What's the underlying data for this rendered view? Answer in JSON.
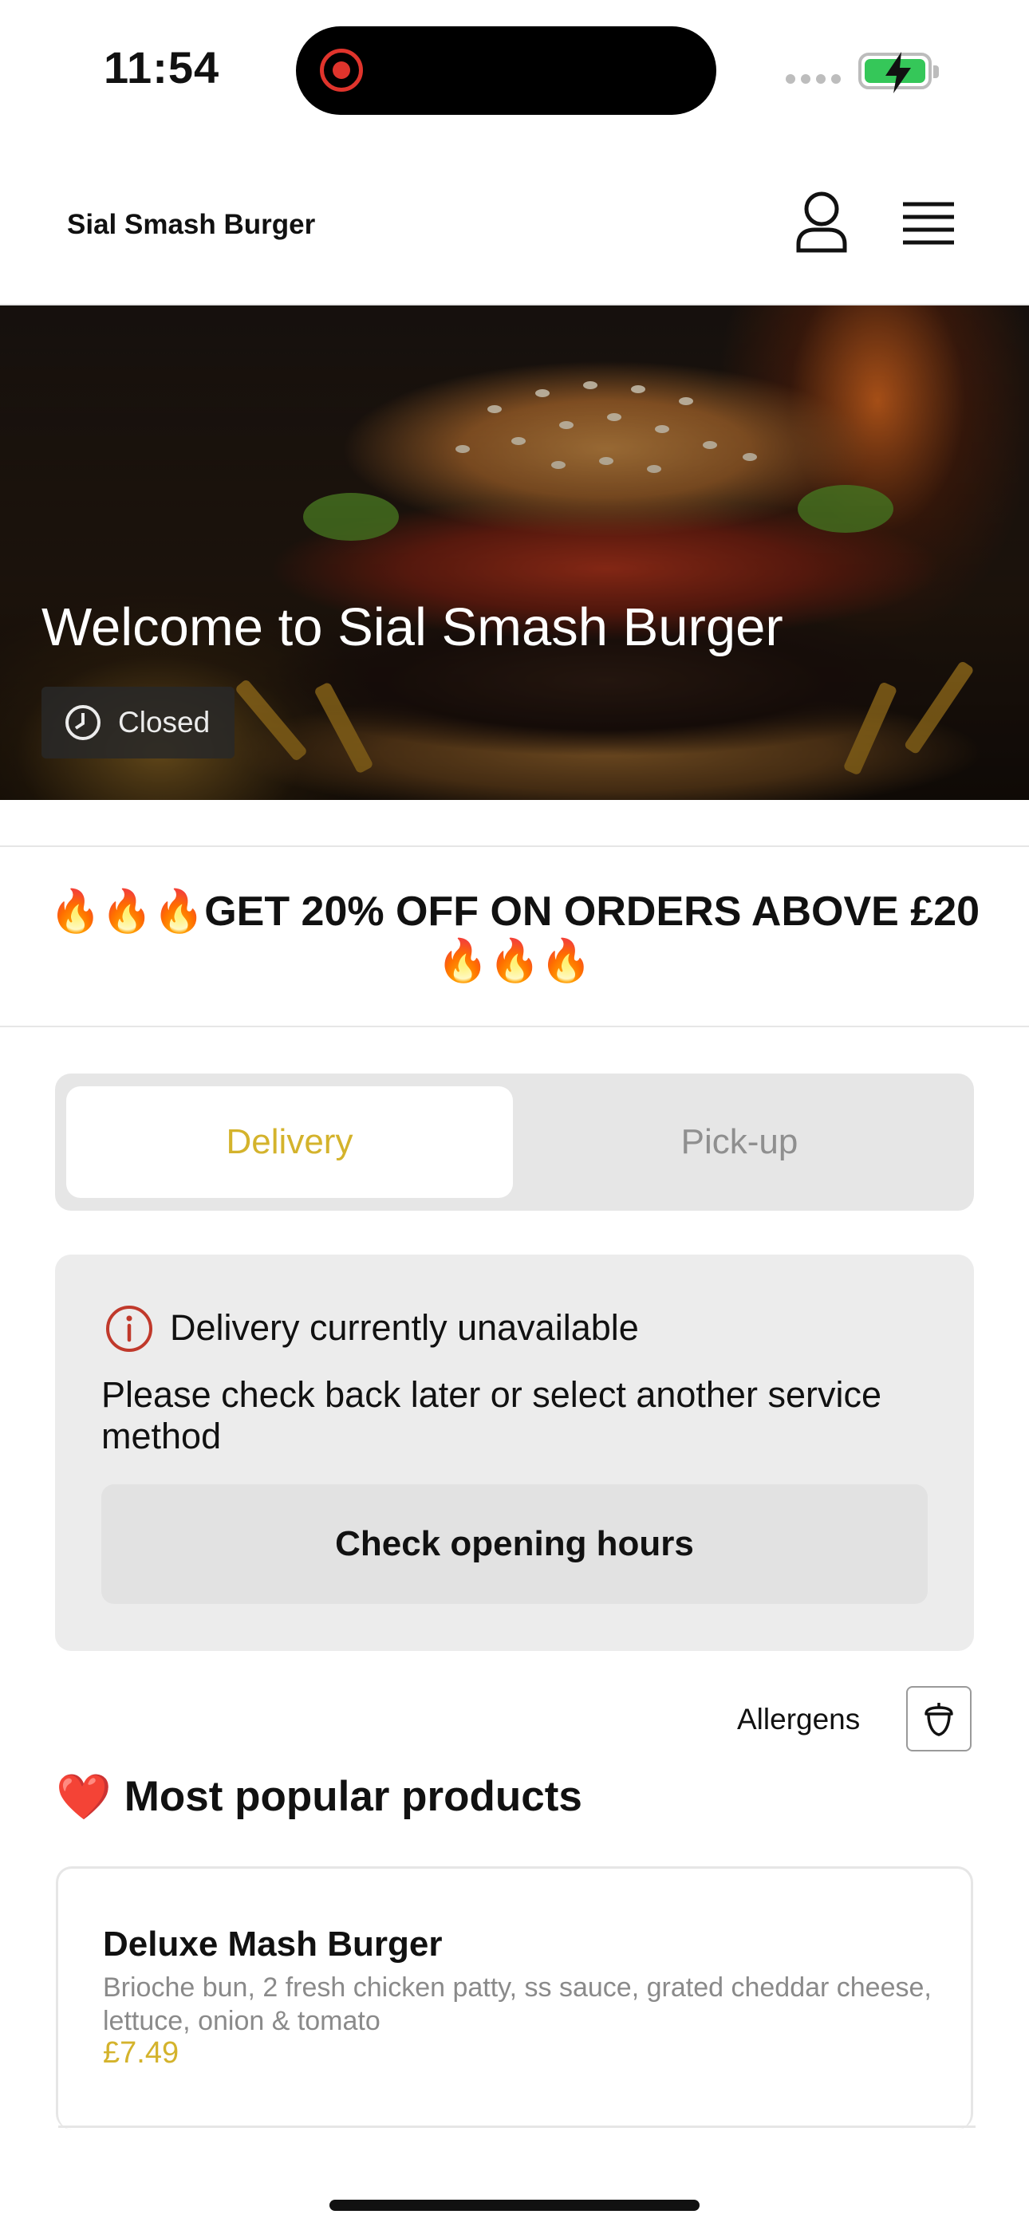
{
  "status_bar": {
    "time": "11:54"
  },
  "header": {
    "brand": "Sial Smash Burger",
    "user_icon": "user-icon",
    "menu_icon": "hamburger-menu-icon"
  },
  "hero": {
    "title": "Welcome to Sial Smash Burger",
    "status": "Closed",
    "status_icon": "clock-icon"
  },
  "promo": {
    "text": "🔥🔥🔥GET 20% OFF ON ORDERS ABOVE £20🔥🔥🔥"
  },
  "service": {
    "tabs": [
      {
        "label": "Delivery",
        "active": true
      },
      {
        "label": "Pick-up",
        "active": false
      }
    ],
    "accent_color": "#d4b32c"
  },
  "notice": {
    "icon": "info-icon",
    "title": "Delivery currently unavailable",
    "body": "Please check back later or select another service method",
    "button": "Check opening hours"
  },
  "allergens": {
    "label": "Allergens",
    "icon": "acorn-icon"
  },
  "popular": {
    "emoji": "❤️",
    "title": "Most popular products",
    "products": [
      {
        "name": "Deluxe Mash Burger",
        "description": "Brioche bun, 2 fresh chicken patty, ss sauce, grated cheddar cheese, lettuce, onion & tomato",
        "price": "£7.49"
      }
    ]
  }
}
